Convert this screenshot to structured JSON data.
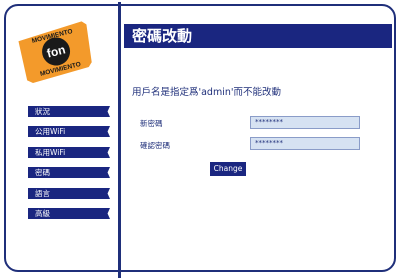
{
  "brand": {
    "logo_word_top": "MOVIMIENTO",
    "logo_word_bottom": "MOVIMIENTO",
    "logo_name": "fon"
  },
  "header": {
    "title": "密碼改動"
  },
  "sidebar": {
    "items": [
      {
        "label": "狀況"
      },
      {
        "label": "公用WiFi"
      },
      {
        "label": "私用WiFi"
      },
      {
        "label": "密碼"
      },
      {
        "label": "語言"
      },
      {
        "label": "高級"
      }
    ]
  },
  "main": {
    "notice": "用戶名是指定爲'admin'而不能改動",
    "new_password_label": "新密碼",
    "confirm_password_label": "確認密碼",
    "new_password_value": "********",
    "confirm_password_value": "********",
    "change_button": "Change"
  },
  "colors": {
    "primary": "#1a2680",
    "logo_orange": "#f39a2b",
    "input_bg": "#d6e2f2"
  }
}
